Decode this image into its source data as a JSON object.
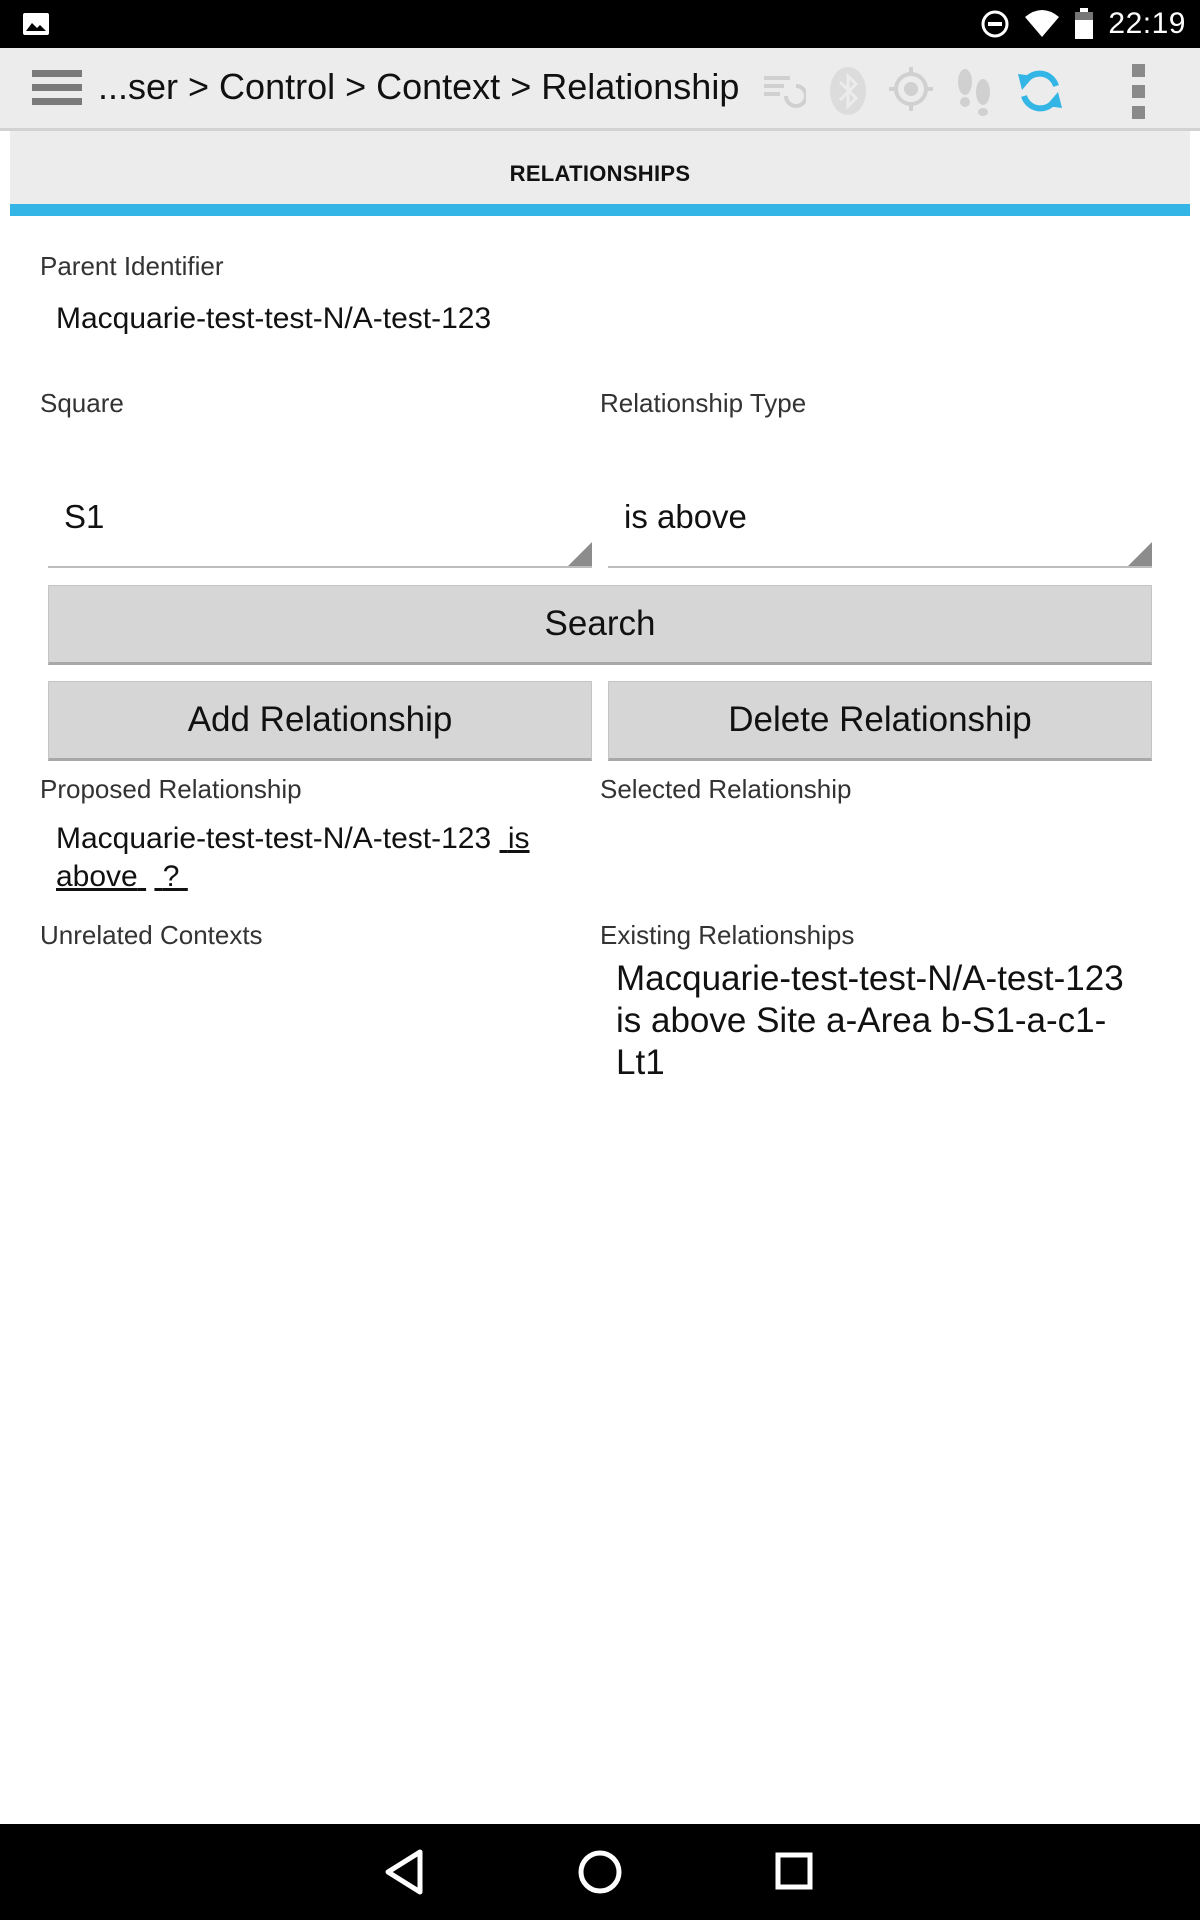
{
  "status_bar": {
    "time": "22:19",
    "icons": [
      "gallery-icon",
      "do-not-disturb-icon",
      "wifi-icon",
      "battery-icon"
    ]
  },
  "action_bar": {
    "breadcrumb": "...ser > Control > Context > Relationship",
    "icons": [
      "hamburger-menu-icon",
      "sync-list-icon",
      "bluetooth-icon",
      "gps-icon",
      "footsteps-icon",
      "sync-icon",
      "overflow-menu-icon"
    ],
    "active_color": "#33b5e5"
  },
  "tab": {
    "label": "RELATIONSHIPS",
    "indicator_color": "#33b5e5"
  },
  "form": {
    "parent_identifier_label": "Parent Identifier",
    "parent_identifier_value": "Macquarie-test-test-N/A-test-123",
    "square_label": "Square",
    "square_value": "S1",
    "relationship_type_label": "Relationship Type",
    "relationship_type_value": "is above",
    "search_button": "Search",
    "add_button": "Add Relationship",
    "delete_button": "Delete Relationship",
    "proposed_label": "Proposed Relationship",
    "proposed_value": "Macquarie-test-test-N/A-test-123",
    "proposed_link_type": "is above",
    "proposed_link_target": "?",
    "selected_label": "Selected Relationship",
    "selected_value": "",
    "unrelated_label": "Unrelated Contexts",
    "existing_label": "Existing Relationships",
    "existing_items": [
      "Macquarie-test-test-N/A-test-123 is above Site a-Area b-S1-a-c1-Lt1"
    ]
  },
  "nav_bar": {
    "icons": [
      "back-icon",
      "home-icon",
      "recents-icon"
    ]
  }
}
